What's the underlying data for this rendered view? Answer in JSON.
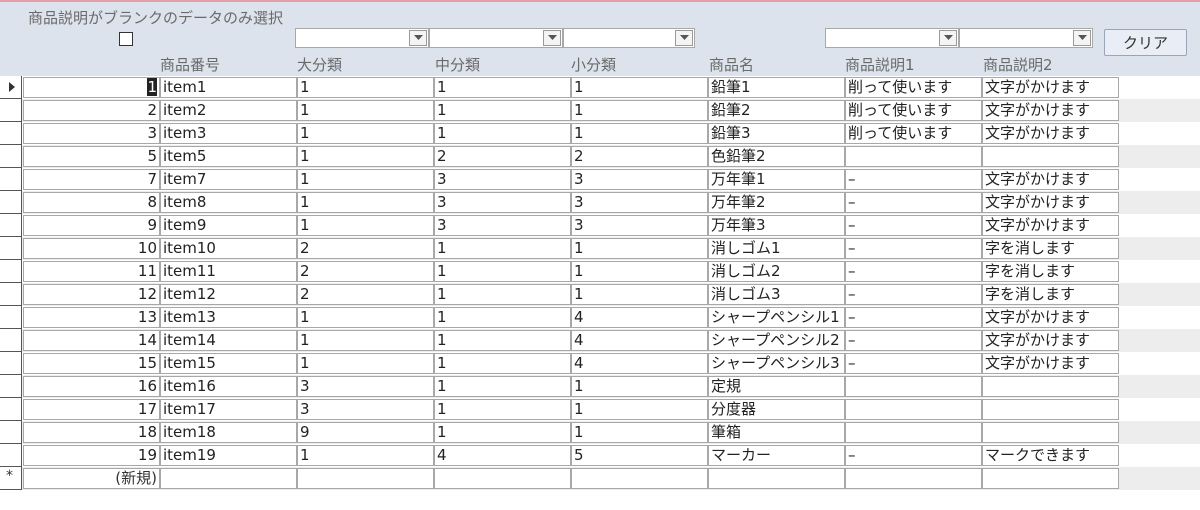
{
  "header": {
    "title": "商品説明がブランクのデータのみ選択",
    "clear_label": "クリア"
  },
  "columns": [
    "商品番号",
    "大分類",
    "中分類",
    "小分類",
    "商品名",
    "商品説明1",
    "商品説明2"
  ],
  "new_record_label": "(新規)",
  "new_record_marker": "*",
  "rows": [
    {
      "no": "1",
      "code": "item1",
      "l": "1",
      "m": "1",
      "s": "1",
      "name": "鉛筆1",
      "d1": "削って使います",
      "d2": "文字がかけます"
    },
    {
      "no": "2",
      "code": "item2",
      "l": "1",
      "m": "1",
      "s": "1",
      "name": "鉛筆2",
      "d1": "削って使います",
      "d2": "文字がかけます"
    },
    {
      "no": "3",
      "code": "item3",
      "l": "1",
      "m": "1",
      "s": "1",
      "name": "鉛筆3",
      "d1": "削って使います",
      "d2": "文字がかけます"
    },
    {
      "no": "5",
      "code": "item5",
      "l": "1",
      "m": "2",
      "s": "2",
      "name": "色鉛筆2",
      "d1": "",
      "d2": ""
    },
    {
      "no": "7",
      "code": "item7",
      "l": "1",
      "m": "3",
      "s": "3",
      "name": "万年筆1",
      "d1": "–",
      "d2": "文字がかけます"
    },
    {
      "no": "8",
      "code": "item8",
      "l": "1",
      "m": "3",
      "s": "3",
      "name": "万年筆2",
      "d1": "–",
      "d2": "文字がかけます"
    },
    {
      "no": "9",
      "code": "item9",
      "l": "1",
      "m": "3",
      "s": "3",
      "name": "万年筆3",
      "d1": "–",
      "d2": "文字がかけます"
    },
    {
      "no": "10",
      "code": "item10",
      "l": "2",
      "m": "1",
      "s": "1",
      "name": "消しゴム1",
      "d1": "–",
      "d2": "字を消します"
    },
    {
      "no": "11",
      "code": "item11",
      "l": "2",
      "m": "1",
      "s": "1",
      "name": "消しゴム2",
      "d1": "–",
      "d2": "字を消します"
    },
    {
      "no": "12",
      "code": "item12",
      "l": "2",
      "m": "1",
      "s": "1",
      "name": "消しゴム3",
      "d1": "–",
      "d2": "字を消します"
    },
    {
      "no": "13",
      "code": "item13",
      "l": "1",
      "m": "1",
      "s": "4",
      "name": "シャープペンシル1",
      "d1": "–",
      "d2": "文字がかけます"
    },
    {
      "no": "14",
      "code": "item14",
      "l": "1",
      "m": "1",
      "s": "4",
      "name": "シャープペンシル2",
      "d1": "–",
      "d2": "文字がかけます"
    },
    {
      "no": "15",
      "code": "item15",
      "l": "1",
      "m": "1",
      "s": "4",
      "name": "シャープペンシル3",
      "d1": "–",
      "d2": "文字がかけます"
    },
    {
      "no": "16",
      "code": "item16",
      "l": "3",
      "m": "1",
      "s": "1",
      "name": "定規",
      "d1": "",
      "d2": ""
    },
    {
      "no": "17",
      "code": "item17",
      "l": "3",
      "m": "1",
      "s": "1",
      "name": "分度器",
      "d1": "",
      "d2": ""
    },
    {
      "no": "18",
      "code": "item18",
      "l": "9",
      "m": "1",
      "s": "1",
      "name": "筆箱",
      "d1": "",
      "d2": ""
    },
    {
      "no": "19",
      "code": "item19",
      "l": "1",
      "m": "4",
      "s": "5",
      "name": "マーカー",
      "d1": "–",
      "d2": "マークできます"
    }
  ]
}
